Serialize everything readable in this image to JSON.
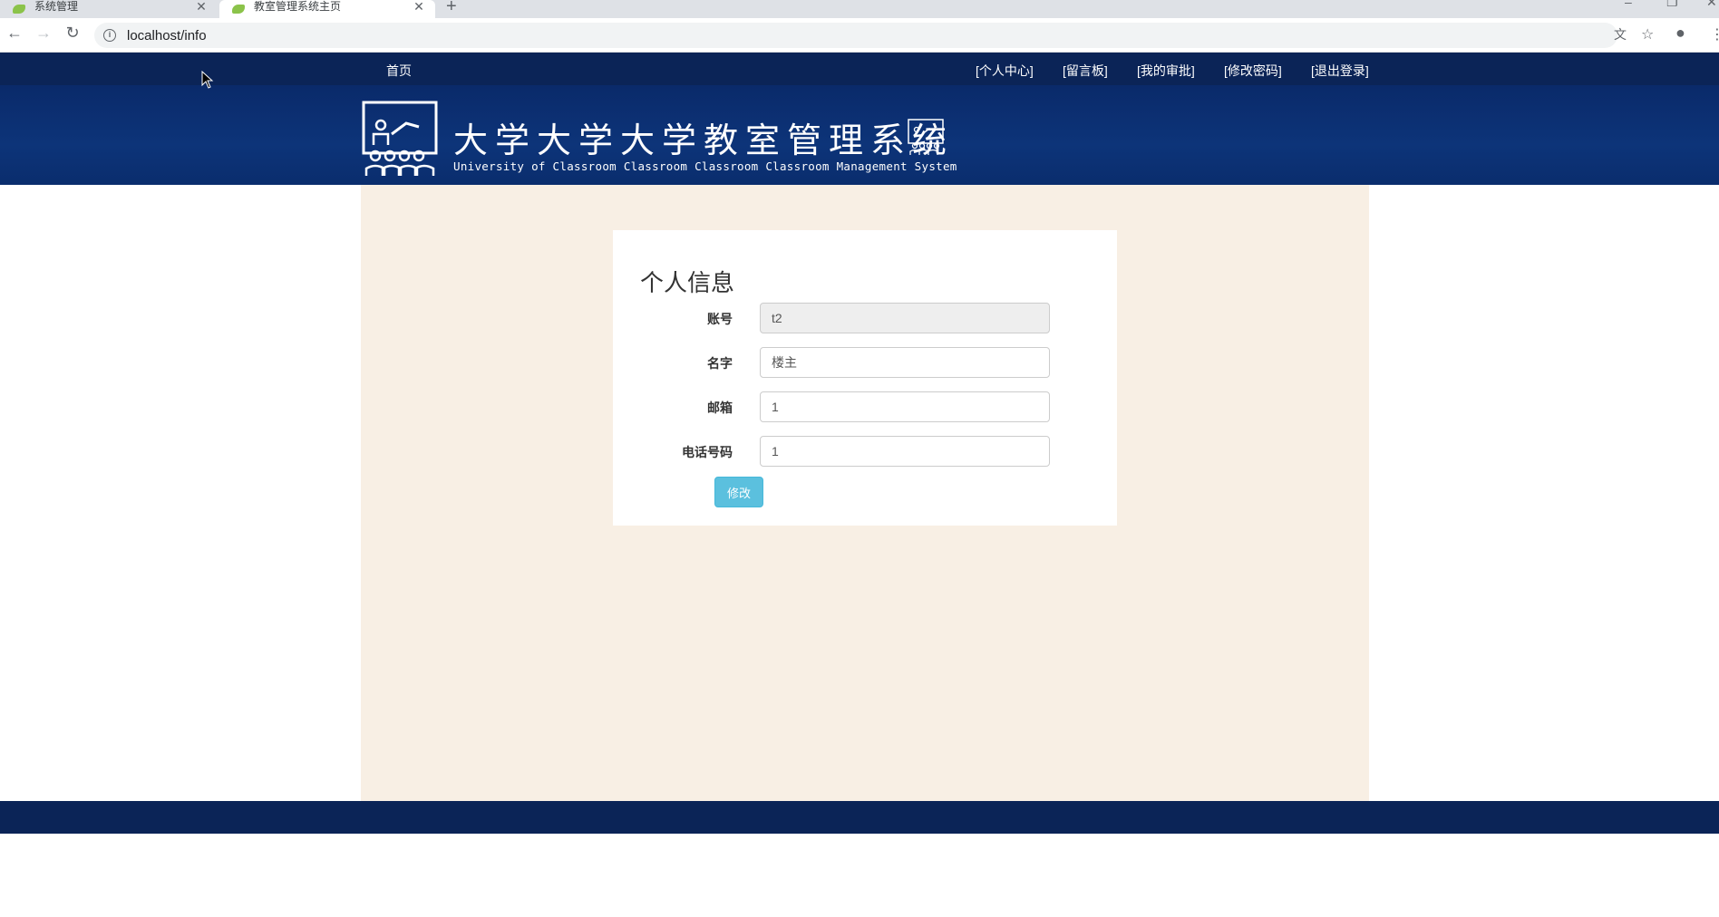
{
  "browser": {
    "tabs": [
      {
        "title": "系统管理",
        "active": false
      },
      {
        "title": "教室管理系统主页",
        "active": true
      }
    ],
    "url": "localhost/info"
  },
  "nav": {
    "home": "首页",
    "personal_center": "[个人中心]",
    "message_board": "[留言板]",
    "my_approvals": "[我的审批]",
    "change_password": "[修改密码]",
    "logout": "[退出登录]"
  },
  "banner": {
    "title": "大学大学大学教室管理系统",
    "subtitle": "University of Classroom Classroom Classroom Classroom Management System"
  },
  "form": {
    "title": "个人信息",
    "fields": [
      {
        "label": "账号",
        "value": "t2",
        "readonly": true
      },
      {
        "label": "名字",
        "value": "楼主",
        "readonly": false
      },
      {
        "label": "邮箱",
        "value": "1",
        "readonly": false
      },
      {
        "label": "电话号码",
        "value": "1",
        "readonly": false
      }
    ],
    "submit_label": "修改"
  },
  "colors": {
    "nav_bg": "#0b2457",
    "banner_bg": "#0d3479",
    "content_bg": "#f8efe4",
    "button_info": "#5bc0de"
  }
}
